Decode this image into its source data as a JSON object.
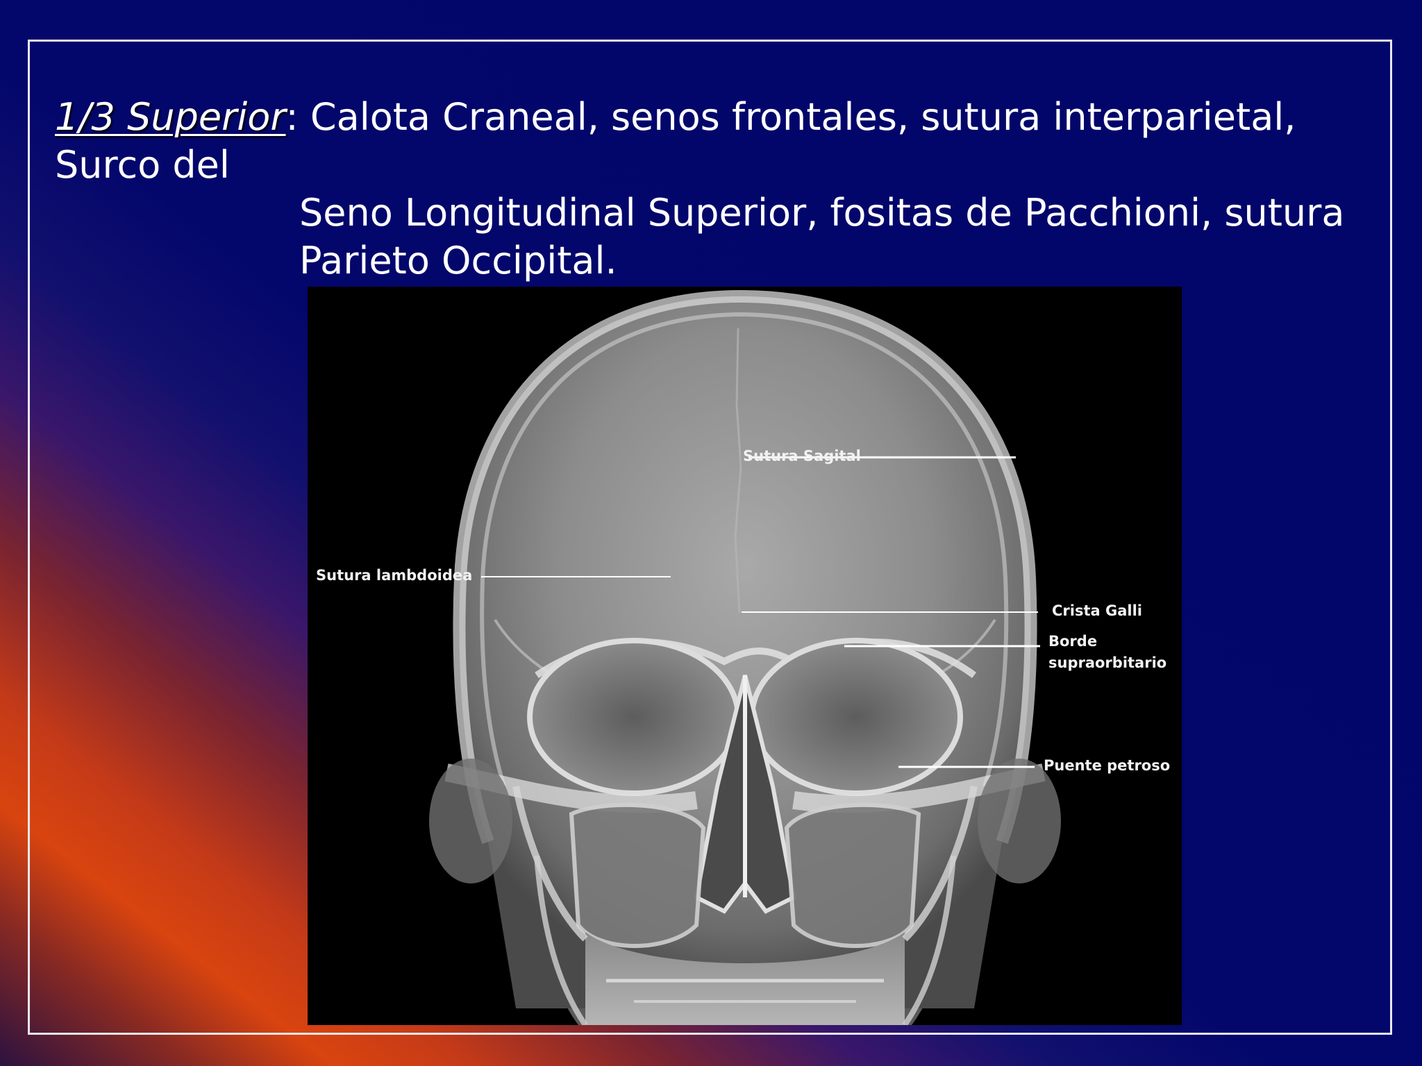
{
  "slide": {
    "heading_lead": "1/3 Superior",
    "heading_colon": ":",
    "heading_line1": " Calota Craneal, senos frontales, sutura interparietal, Surco del",
    "heading_line2": "Seno Longitudinal Superior, fositas de Pacchioni, sutura",
    "heading_line3": "Parieto Occipital."
  },
  "xray": {
    "labels": {
      "sutura_sagital": "Sutura Sagital",
      "sutura_lambdoidea": "Sutura lambdoidea",
      "crista_galli": "Crista Galli",
      "borde_line1": "Borde",
      "borde_line2": "supraorbitario",
      "puente_petroso": "Puente petroso"
    }
  },
  "colors": {
    "background_navy": "#02066a",
    "gradient_orange": "#d9440f",
    "text": "#ffffff"
  }
}
